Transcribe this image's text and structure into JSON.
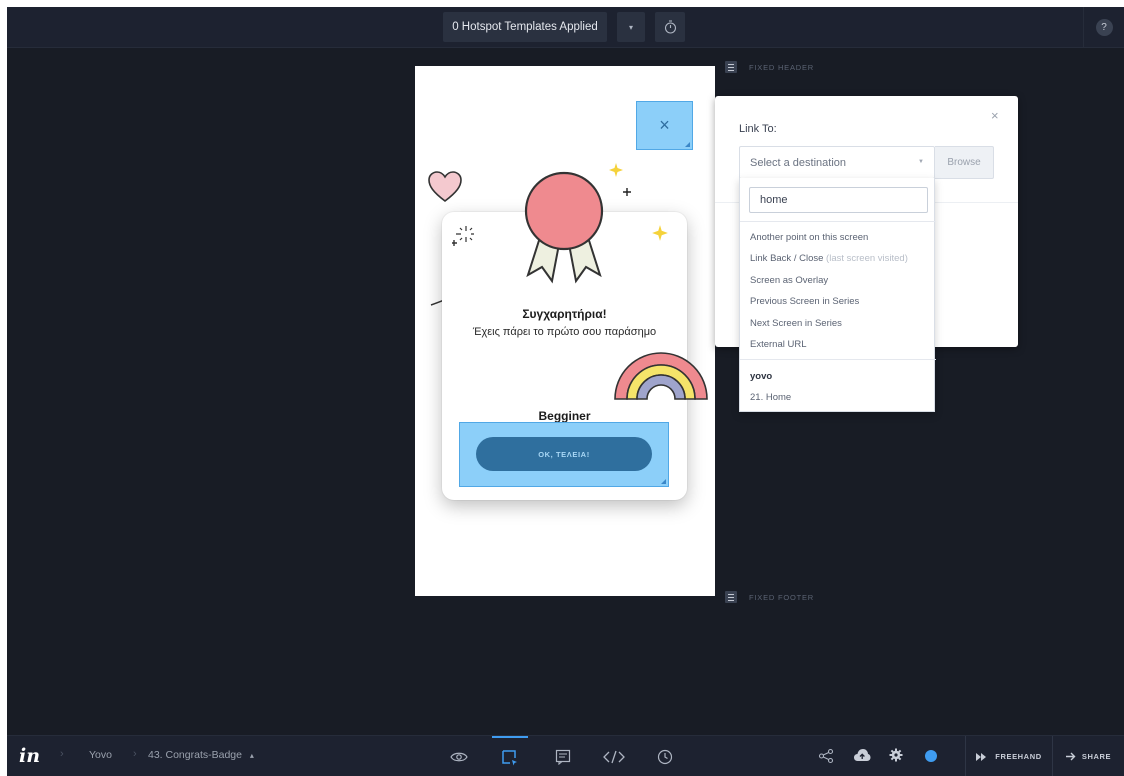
{
  "topbar": {
    "templates_label": "0 Hotspot Templates Applied",
    "templates_caret": "▾",
    "help_label": "?"
  },
  "canvas": {
    "fixed_header_label": "FIXED HEADER",
    "fixed_footer_label": "FIXED FOOTER"
  },
  "screen": {
    "close_glyph": "×",
    "title": "Συγχαρητήρια!",
    "subtitle": "Έχεις πάρει το πρώτο σου παράσημο",
    "level": "Begginer",
    "ok_button": "ΟΚ, ΤΕΛΕΙΑ!"
  },
  "link_panel": {
    "title": "Link To:",
    "close_glyph": "×",
    "destination_placeholder": "Select a destination",
    "browse_label": "Browse",
    "search_value": "home",
    "options": [
      "Another point on this screen",
      "Link Back / Close",
      "Screen as Overlay",
      "Previous Screen in Series",
      "Next Screen in Series",
      "External URL"
    ],
    "link_back_hint": "(last screen visited)",
    "group_label": "yovo",
    "group_items": [
      "21. Home"
    ]
  },
  "bottombar": {
    "logo": "in",
    "project": "Yovo",
    "screen": "43. Congrats-Badge",
    "screen_caret": "▴",
    "freehand_label": "FREEHAND",
    "share_label": "SHARE"
  },
  "colors": {
    "app_bg": "#181c25",
    "bar_bg": "#1d2230",
    "hotspot": "#8ccff9",
    "accent_blue": "#3f9cf0",
    "ok_button": "#2f6f9e",
    "medal": "#ef8a8f"
  },
  "icons": {
    "timer": "stopwatch-icon",
    "preview": "eye-icon",
    "build": "hotspot-select-icon",
    "comment": "comment-icon",
    "inspect": "code-icon",
    "history": "clock-icon",
    "share_graph": "share-nodes-icon",
    "cloud": "cloud-upload-icon",
    "settings": "gear-icon",
    "status": "status-dot-icon"
  }
}
